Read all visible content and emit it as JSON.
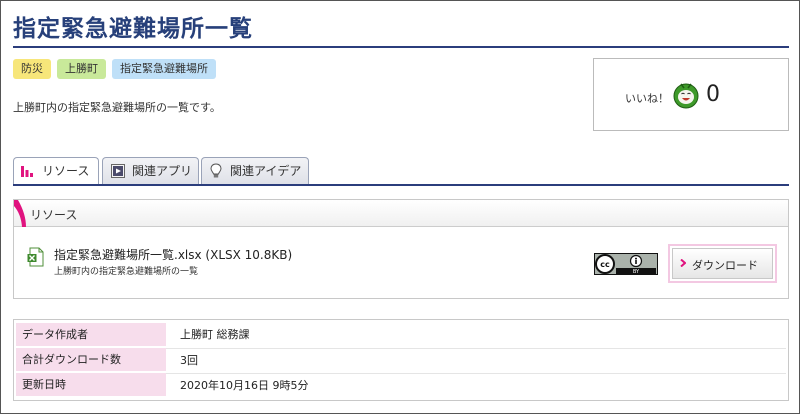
{
  "page": {
    "title": "指定緊急避難場所一覧",
    "tags": [
      "防災",
      "上勝町",
      "指定緊急避難場所"
    ],
    "description": "上勝町内の指定緊急避難場所の一覧です。"
  },
  "like": {
    "label": "いいね！",
    "count": "0",
    "face_icon": "smiling-face-icon"
  },
  "tabs": [
    {
      "label": "リソース",
      "icon": "bar-chart-icon"
    },
    {
      "label": "関連アプリ",
      "icon": "app-window-icon"
    },
    {
      "label": "関連アイデア",
      "icon": "lightbulb-icon"
    }
  ],
  "resource": {
    "header": "リソース",
    "file_name": "指定緊急避難場所一覧.xlsx (XLSX 10.8KB)",
    "file_description": "上勝町内の指定緊急避難場所の一覧",
    "file_icon": "excel-file-icon",
    "license_icon": "cc-by-license-icon",
    "download_label": "ダウンロード"
  },
  "meta": {
    "rows": [
      {
        "key": "データ作成者",
        "value": "上勝町 総務課"
      },
      {
        "key": "合計ダウンロード数",
        "value": "3回"
      },
      {
        "key": "更新日時",
        "value": "2020年10月16日 9時5分"
      }
    ]
  },
  "colors": {
    "title_blue": "#27407a",
    "accent_magenta": "#e0137f",
    "tag_yellow": "#f7e67a",
    "tag_green": "#c9e99a",
    "tag_blue": "#bfe0f8",
    "meta_pink": "#f7ddec"
  }
}
